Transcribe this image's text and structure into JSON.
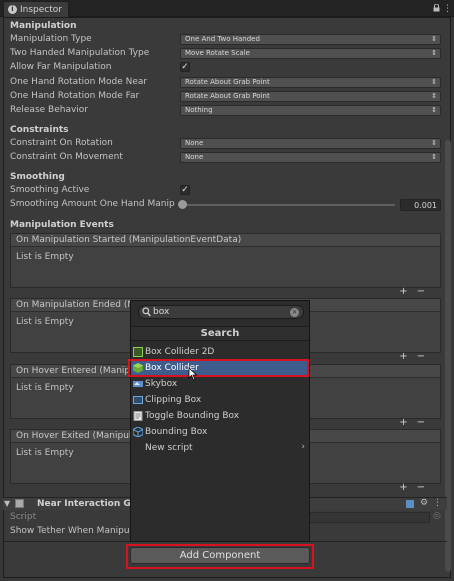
{
  "tab": {
    "title": "Inspector"
  },
  "manipulation": {
    "header": "Manipulation",
    "rows": [
      {
        "label": "Manipulation Type",
        "value": "One And Two Handed"
      },
      {
        "label": "Two Handed Manipulation Type",
        "value": "Move Rotate Scale"
      },
      {
        "label": "Allow Far Manipulation",
        "checked": true
      },
      {
        "label": "One Hand Rotation Mode Near",
        "value": "Rotate About Grab Point"
      },
      {
        "label": "One Hand Rotation Mode Far",
        "value": "Rotate About Grab Point"
      },
      {
        "label": "Release Behavior",
        "value": "Nothing"
      }
    ]
  },
  "constraints": {
    "header": "Constraints",
    "rows": [
      {
        "label": "Constraint On Rotation",
        "value": "None"
      },
      {
        "label": "Constraint On Movement",
        "value": "None"
      }
    ]
  },
  "smoothing": {
    "header": "Smoothing",
    "active_label": "Smoothing Active",
    "active_checked": true,
    "amount_label": "Smoothing Amount One Hand Manip",
    "amount_value": "0.001"
  },
  "events": {
    "header": "Manipulation Events",
    "list": [
      {
        "title": "On Manipulation Started (ManipulationEventData)",
        "body": "List is Empty"
      },
      {
        "title": "On Manipulation Ended (M",
        "body": "List is Empty"
      },
      {
        "title": "On Hover Entered (Manipu",
        "body": "List is Empty"
      },
      {
        "title": "On Hover Exited (Manipul",
        "body": "List is Empty"
      }
    ],
    "plus": "+",
    "minus": "−"
  },
  "component": {
    "title": "Near Interaction G",
    "script_label": "Script",
    "tether_label": "Show Tether When Manipu"
  },
  "popup": {
    "search_value": "box",
    "header": "Search",
    "items": [
      {
        "label": "Box Collider 2D",
        "icon": "box-collider-2d-icon"
      },
      {
        "label": "Box Collider",
        "icon": "box-collider-icon"
      },
      {
        "label": "Skybox",
        "icon": "skybox-icon"
      },
      {
        "label": "Clipping Box",
        "icon": "clipping-box-icon"
      },
      {
        "label": "Toggle Bounding Box",
        "icon": "script-icon"
      },
      {
        "label": "Bounding Box",
        "icon": "bounding-box-icon"
      },
      {
        "label": "New script",
        "icon": ""
      }
    ],
    "selected_index": 1
  },
  "add_component": {
    "label": "Add Component"
  },
  "colors": {
    "highlight": "#d9121f",
    "selection": "#3e5d8d"
  }
}
